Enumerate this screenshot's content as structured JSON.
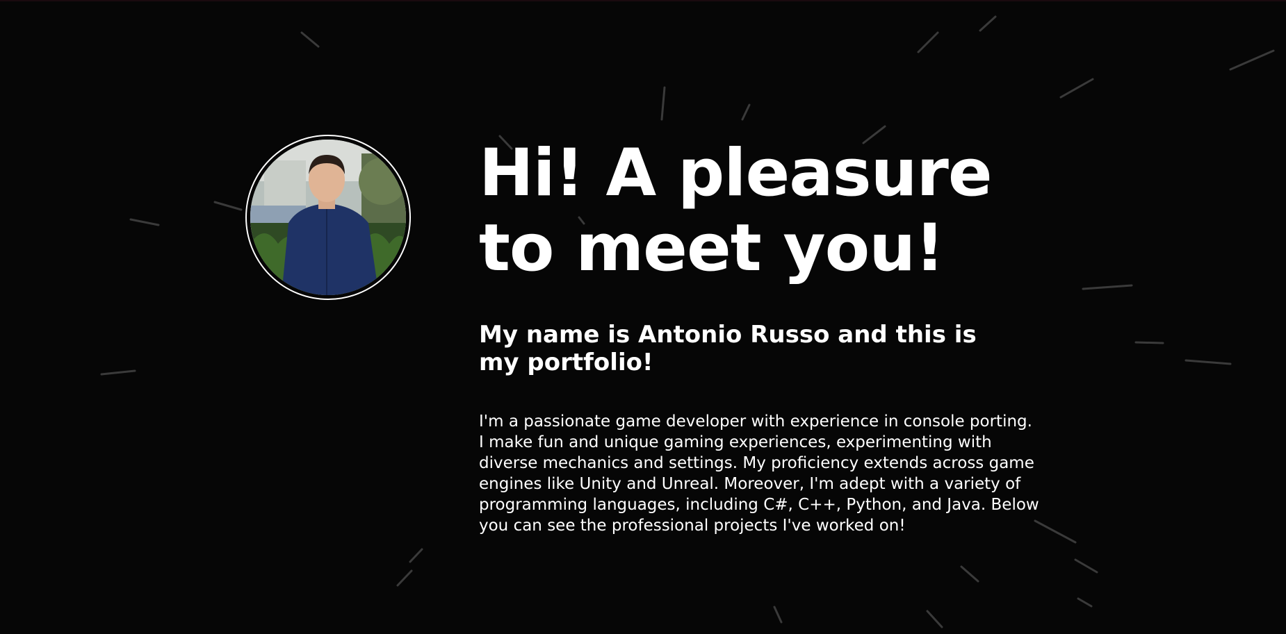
{
  "hero": {
    "headline": "Hi! A pleasure to meet you!",
    "subheading": "My name is Antonio Russo and this is my portfolio!",
    "bio": "I'm a passionate game developer with experience in console porting. I make fun and unique gaming experiences, experimenting with diverse mechanics and settings. My proficiency extends across game engines like Unity and Unreal. Moreover, I'm adept with a variety of programming languages, including C#, C++, Python, and Java. Below you can see the professional projects I've worked on!"
  },
  "colors": {
    "background": "#060606",
    "text": "#ffffff",
    "streak": "#3a3a3a"
  }
}
